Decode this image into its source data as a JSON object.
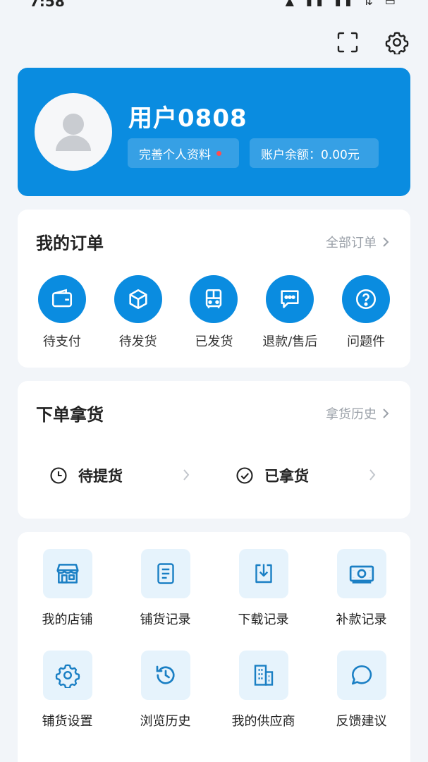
{
  "status_bar": {
    "time": "7:58",
    "icons_text": "▲ ▮▮ ▮▮ ⇅ ▭"
  },
  "header": {
    "icons": [
      "scan-icon",
      "gear-icon"
    ]
  },
  "profile": {
    "username": "用户0808",
    "edit_label": "完善个人资料",
    "balance_label": "账户余额：0.00元",
    "accent_color": "#0a8ce0"
  },
  "orders": {
    "title": "我的订单",
    "all_link": "全部订单",
    "items": [
      {
        "label": "待支付",
        "icon": "wallet-icon"
      },
      {
        "label": "待发货",
        "icon": "box-icon"
      },
      {
        "label": "已发货",
        "icon": "bus-icon"
      },
      {
        "label": "退款/售后",
        "icon": "chat-icon"
      },
      {
        "label": "问题件",
        "icon": "question-icon"
      }
    ]
  },
  "pickup": {
    "title": "下单拿货",
    "history_link": "拿货历史",
    "pending_label": "待提货",
    "done_label": "已拿货"
  },
  "tools": {
    "items": [
      {
        "label": "我的店铺",
        "icon": "store-icon"
      },
      {
        "label": "铺货记录",
        "icon": "document-icon"
      },
      {
        "label": "下载记录",
        "icon": "download-icon"
      },
      {
        "label": "补款记录",
        "icon": "money-icon"
      },
      {
        "label": "铺货设置",
        "icon": "gear-icon"
      },
      {
        "label": "浏览历史",
        "icon": "history-icon"
      },
      {
        "label": "我的供应商",
        "icon": "building-icon"
      },
      {
        "label": "反馈建议",
        "icon": "speech-bubble-icon"
      }
    ]
  }
}
